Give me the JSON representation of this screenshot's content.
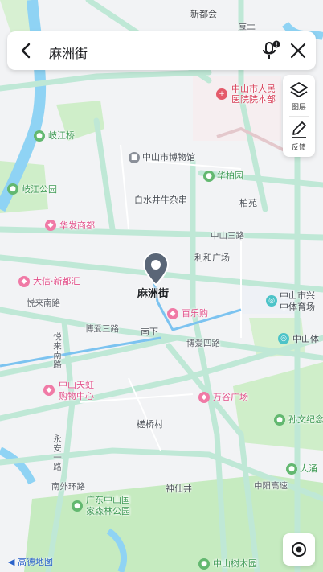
{
  "search": {
    "query": "麻洲街"
  },
  "side_panel": {
    "layers_label": "图层",
    "feedback_label": "反馈"
  },
  "marker": {
    "label": "麻洲街"
  },
  "logo": {
    "text": "高德地图"
  },
  "map_labels": {
    "xinduhui": "新都会",
    "zhongshan_hospital": "中山市人民医院院本部",
    "qixia_bridge": "岐江桥",
    "museum": "中山市博物馆",
    "huabai_garden": "华柏园",
    "qijiang_park": "岐江公园",
    "baishuijing": "白水井牛杂串",
    "baiyuan": "柏苑",
    "huafa_mall": "华发商都",
    "zhongshan3": "中山三路",
    "lihe_plaza": "利和广场",
    "daxin": "大信·新都汇",
    "yuelai_south": "悦来南路",
    "zhongshan_xing": "中山市兴",
    "sports_center": "中体育场",
    "bailegou": "百乐购",
    "boai3": "博爱三路",
    "nanxia": "南下",
    "boai4": "博爱四路",
    "zhongshan_ti": "中山体",
    "yuelai_south_v": "悦来南路",
    "tianhong_1": "中山天虹",
    "tianhong_2": "购物中心",
    "wangu": "万谷广场",
    "sunwen_park": "孙文纪念",
    "jiaoqiao": "槎桥村",
    "yongan1": "永安一路",
    "dayong": "大涌",
    "nanwai": "南外环路",
    "zhongyang_expressway": "中阳高速",
    "shenxianjing": "神仙井",
    "forest_park_1": "广东中山国",
    "forest_park_2": "家森林公园",
    "zhongshan_tree": "中山树木园",
    "hu_top": "厚丰"
  },
  "colors": {
    "road": "#bfe8d6",
    "road_edge": "#9fd9c2",
    "park": "#cfeec9",
    "water": "#8fd3f4",
    "route": "#3a8fd8"
  }
}
